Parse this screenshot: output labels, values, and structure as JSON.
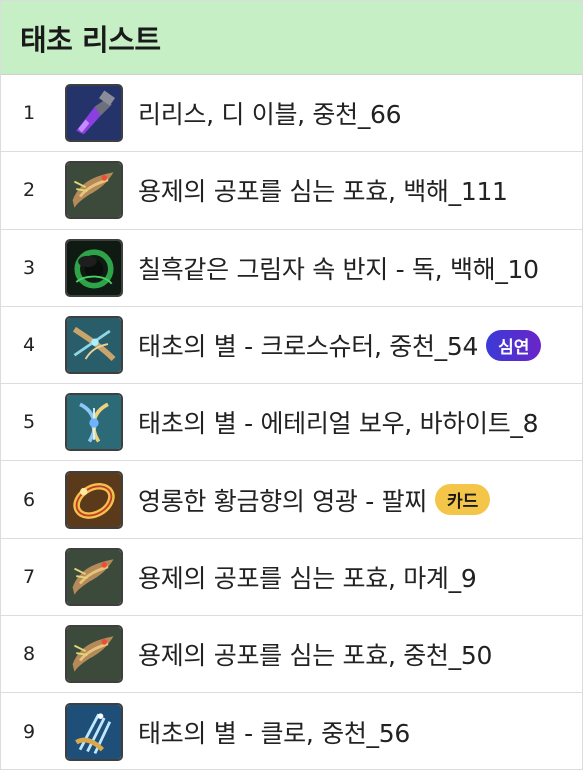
{
  "header": {
    "title": "태초 리스트"
  },
  "items": [
    {
      "number": "1",
      "name": "리리스, 디 이블, 중천_66",
      "icon": "purple-gauntlet-icon",
      "badge": null
    },
    {
      "number": "2",
      "name": "용제의 공포를 심는 포효, 백해_111",
      "icon": "dragon-relic-icon",
      "badge": null
    },
    {
      "number": "3",
      "name": "칠흑같은 그림자 속 반지 - 독, 백해_10",
      "icon": "dark-ring-icon",
      "badge": null
    },
    {
      "number": "4",
      "name": "태초의 별 - 크로스슈터, 중천_54",
      "icon": "crossbow-icon",
      "badge": {
        "label": "심연",
        "color": "#4b32d6"
      }
    },
    {
      "number": "5",
      "name": "태초의 별 - 에테리얼 보우, 바하이트_8",
      "icon": "ethereal-bow-icon",
      "badge": null
    },
    {
      "number": "6",
      "name": "영롱한 황금향의 영광 - 팔찌",
      "icon": "golden-bracelet-icon",
      "badge": {
        "label": "카드",
        "color": "#f3c64a"
      }
    },
    {
      "number": "7",
      "name": "용제의 공포를 심는 포효, 마계_9",
      "icon": "dragon-relic-icon",
      "badge": null
    },
    {
      "number": "8",
      "name": "용제의 공포를 심는 포효, 중천_50",
      "icon": "dragon-relic-icon",
      "badge": null
    },
    {
      "number": "9",
      "name": "태초의 별 - 클로, 중천_56",
      "icon": "claw-icon",
      "badge": null
    }
  ]
}
